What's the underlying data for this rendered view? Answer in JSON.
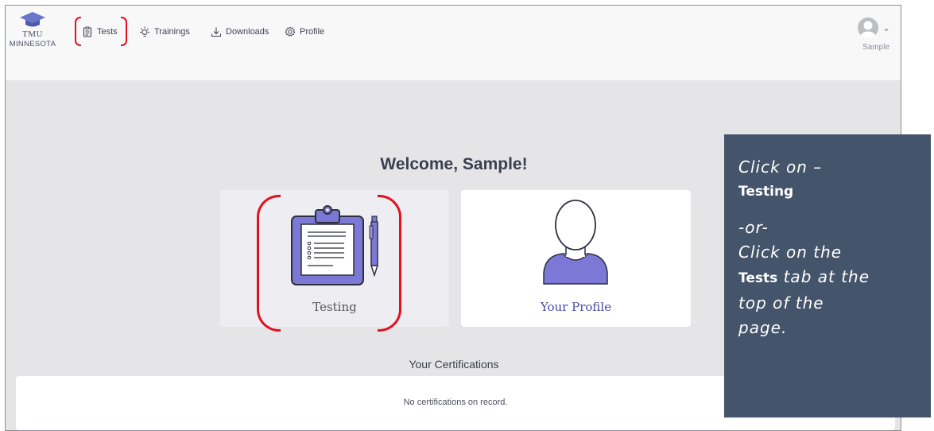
{
  "app": {
    "logo_line1": "TMU",
    "logo_line2": "MINNESOTA"
  },
  "nav": {
    "items": [
      {
        "label": "Tests",
        "icon": "clipboard-icon"
      },
      {
        "label": "Trainings",
        "icon": "lightbulb-icon"
      },
      {
        "label": "Downloads",
        "icon": "download-icon"
      },
      {
        "label": "Profile",
        "icon": "gear-icon"
      }
    ]
  },
  "user": {
    "name": "Sample",
    "chevron": "⌄"
  },
  "main": {
    "welcome": "Welcome, Sample!",
    "cards": [
      {
        "label": "Testing",
        "icon": "clipboard-pen-icon"
      },
      {
        "label": "Your Profile",
        "icon": "person-silhouette-icon"
      }
    ],
    "certifications_title": "Your Certifications",
    "certifications_empty": "No certifications on record."
  },
  "callout": {
    "line1": "Click on –",
    "line2": "Testing",
    "line3": "-or-",
    "line4": "Click on the",
    "line5_bold": "Tests",
    "line5_rest": " tab at the",
    "line6": "top of the",
    "line7": "page."
  },
  "colors": {
    "accent_red": "#e3101e",
    "callout_bg": "#44546a",
    "icon_purple": "#7b78d6",
    "profile_label": "#4a4aa8"
  }
}
